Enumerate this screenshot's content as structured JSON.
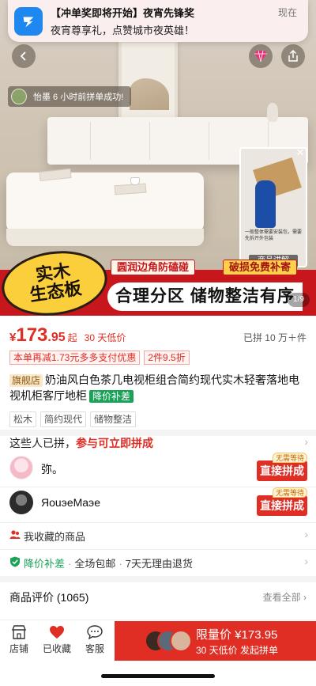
{
  "notification": {
    "title": "【冲单奖即将开始】夜宵先锋奖",
    "body": "夜宵尊享礼，点赞城市夜英雄！",
    "time": "现在",
    "icon": "blue-app-icon"
  },
  "hero": {
    "group_toast": "怡墨 6 小时前拼单成功!",
    "promo_tags": [
      "圆润边角防磕碰",
      "破损免费补寄"
    ],
    "seal_lines": [
      "实木",
      "生态板"
    ],
    "slogan": "合理分区 储物整洁有序",
    "video_label": "商品讲解",
    "video_caption": "一般整体需要安装包，需要先拆开外包装",
    "page_indicator": "1/9"
  },
  "price": {
    "symbol": "¥",
    "integer": "173",
    "decimal": ".95",
    "suffix": "起",
    "low_note": "30 天低价",
    "sold": "已拼 10 万＋件"
  },
  "coupons": [
    "本单再减1.73元多多支付优惠",
    "2件9.5折"
  ],
  "product": {
    "flag_badge": "旗舰店",
    "title": "奶油风白色茶几电视柜组合简约现代实木轻奢落地电视机柜客厅地柜",
    "green_badge": "降价补差"
  },
  "chips": [
    "松木",
    "简约现代",
    "储物整洁"
  ],
  "group_buy": {
    "header_prefix": "这些人已拼，",
    "header_action": "参与可立即拼成",
    "rows": [
      {
        "name": "弥。",
        "button": "直接拼成",
        "tag": "无需等待"
      },
      {
        "name": "ЯouэeMaэe",
        "button": "直接拼成",
        "tag": "无需等待"
      }
    ]
  },
  "favorites_row": "我收藏的商品",
  "guarantee": {
    "items": [
      "降价补差",
      "全场包邮",
      "7天无理由退货"
    ]
  },
  "reviews": {
    "title": "商品评价 (1065)",
    "view_all": "查看全部"
  },
  "bottom_bar": {
    "tabs": [
      {
        "label": "店铺",
        "icon": "store-icon"
      },
      {
        "label": "已收藏",
        "icon": "heart-icon"
      },
      {
        "label": "客服",
        "icon": "chat-icon"
      }
    ],
    "buy_line1": "限量价 ¥173.95",
    "buy_line2": "30 天低价 发起拼单"
  },
  "colors": {
    "accent_red": "#e02e24",
    "guarantee_green": "#1aa358",
    "notif_icon_blue": "#1e88f0"
  }
}
